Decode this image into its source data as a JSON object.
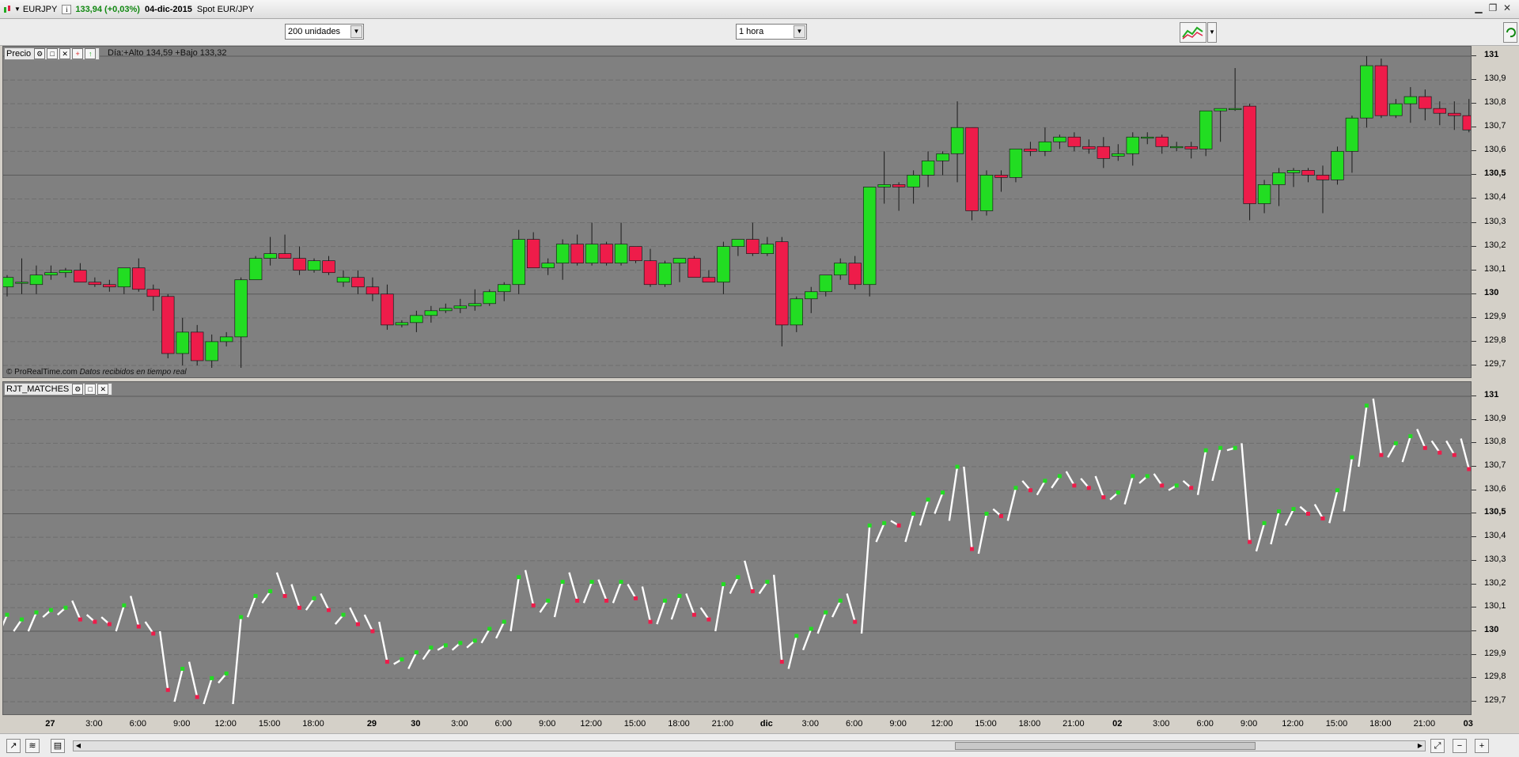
{
  "titlebar": {
    "symbol": "EURJPY",
    "info_glyph": "i",
    "price_change": "133,94 (+0,03%)",
    "date": "04-dic-2015",
    "description": "Spot EUR/JPY"
  },
  "toolbar": {
    "units_select": "200 unidades",
    "timeframe_select": "1 hora"
  },
  "price_panel": {
    "name": "Precio",
    "day_stats": "Día:+Alto 134,59 +Bajo 133,32",
    "credit": "© ProRealTime.com",
    "credit_note": "Datos recibidos en tiempo real"
  },
  "indicator_panel": {
    "name": "RJT_MATCHES"
  },
  "colors": {
    "background": "#808080",
    "up": "#22dd22",
    "down": "#ee1c4a",
    "line": "#ffffff"
  },
  "icons": {
    "titlebar": [
      "chart-symbol-icon",
      "info-icon"
    ],
    "panel_header": [
      "wrench-icon",
      "maximize-icon",
      "close-icon",
      "add-icon",
      "move-up-icon"
    ],
    "bottom": [
      "zoom-in-icon",
      "zoom-out-icon",
      "zoom-fit-icon"
    ]
  },
  "chart_data": {
    "type": "candlestick",
    "y_range": [
      129.67,
      131.02
    ],
    "y_ticks": [
      "131",
      "130,9",
      "130,8",
      "130,7",
      "130,6",
      "130,5",
      "130,4",
      "130,3",
      "130,2",
      "130,1",
      "130",
      "129,9",
      "129,8",
      "129,7"
    ],
    "y_major": [
      "131",
      "130,5",
      "130"
    ],
    "x_ticks": [
      {
        "label": "27",
        "idx": 3,
        "major": true
      },
      {
        "label": "3:00",
        "idx": 6
      },
      {
        "label": "6:00",
        "idx": 9
      },
      {
        "label": "9:00",
        "idx": 12
      },
      {
        "label": "12:00",
        "idx": 15
      },
      {
        "label": "15:00",
        "idx": 18
      },
      {
        "label": "18:00",
        "idx": 21
      },
      {
        "label": "29",
        "idx": 25,
        "major": true
      },
      {
        "label": "30",
        "idx": 28,
        "major": true
      },
      {
        "label": "3:00",
        "idx": 31
      },
      {
        "label": "6:00",
        "idx": 34
      },
      {
        "label": "9:00",
        "idx": 37
      },
      {
        "label": "12:00",
        "idx": 40
      },
      {
        "label": "15:00",
        "idx": 43
      },
      {
        "label": "18:00",
        "idx": 46
      },
      {
        "label": "21:00",
        "idx": 49
      },
      {
        "label": "dic",
        "idx": 52,
        "major": true
      },
      {
        "label": "3:00",
        "idx": 55
      },
      {
        "label": "6:00",
        "idx": 58
      },
      {
        "label": "9:00",
        "idx": 61
      },
      {
        "label": "12:00",
        "idx": 64
      },
      {
        "label": "15:00",
        "idx": 67
      },
      {
        "label": "18:00",
        "idx": 70
      },
      {
        "label": "21:00",
        "idx": 73
      },
      {
        "label": "02",
        "idx": 76,
        "major": true
      },
      {
        "label": "3:00",
        "idx": 79
      },
      {
        "label": "6:00",
        "idx": 82
      },
      {
        "label": "9:00",
        "idx": 85
      },
      {
        "label": "12:00",
        "idx": 88
      },
      {
        "label": "15:00",
        "idx": 91
      },
      {
        "label": "18:00",
        "idx": 94
      },
      {
        "label": "21:00",
        "idx": 97
      },
      {
        "label": "03",
        "idx": 100,
        "major": true
      }
    ],
    "ohlc": [
      [
        130.03,
        130.08,
        129.99,
        130.07
      ],
      [
        130.05,
        130.15,
        130.0,
        130.05
      ],
      [
        130.04,
        130.12,
        130.0,
        130.08
      ],
      [
        130.08,
        130.12,
        130.06,
        130.09
      ],
      [
        130.09,
        130.11,
        130.07,
        130.1
      ],
      [
        130.1,
        130.13,
        130.06,
        130.05
      ],
      [
        130.05,
        130.07,
        130.03,
        130.04
      ],
      [
        130.04,
        130.06,
        130.01,
        130.03
      ],
      [
        130.03,
        130.11,
        130.0,
        130.11
      ],
      [
        130.11,
        130.15,
        130.01,
        130.02
      ],
      [
        130.02,
        130.04,
        129.93,
        129.99
      ],
      [
        129.99,
        130.0,
        129.73,
        129.75
      ],
      [
        129.75,
        129.9,
        129.7,
        129.84
      ],
      [
        129.84,
        129.87,
        129.7,
        129.72
      ],
      [
        129.72,
        129.83,
        129.69,
        129.8
      ],
      [
        129.8,
        129.84,
        129.78,
        129.82
      ],
      [
        129.82,
        130.07,
        129.69,
        130.06
      ],
      [
        130.06,
        130.16,
        130.06,
        130.15
      ],
      [
        130.15,
        130.24,
        130.12,
        130.17
      ],
      [
        130.17,
        130.25,
        130.16,
        130.15
      ],
      [
        130.15,
        130.2,
        130.08,
        130.1
      ],
      [
        130.1,
        130.15,
        130.09,
        130.14
      ],
      [
        130.14,
        130.16,
        130.08,
        130.09
      ],
      [
        130.05,
        130.1,
        130.03,
        130.07
      ],
      [
        130.07,
        130.1,
        130.0,
        130.03
      ],
      [
        130.03,
        130.07,
        129.97,
        130.0
      ],
      [
        130.0,
        130.04,
        129.85,
        129.87
      ],
      [
        129.87,
        129.89,
        129.86,
        129.88
      ],
      [
        129.88,
        129.93,
        129.84,
        129.91
      ],
      [
        129.91,
        129.95,
        129.88,
        129.93
      ],
      [
        129.93,
        129.96,
        129.92,
        129.94
      ],
      [
        129.94,
        129.98,
        129.92,
        129.95
      ],
      [
        129.95,
        130.02,
        129.93,
        129.96
      ],
      [
        129.96,
        130.02,
        129.95,
        130.01
      ],
      [
        130.01,
        130.05,
        129.97,
        130.04
      ],
      [
        130.04,
        130.27,
        130.0,
        130.23
      ],
      [
        130.23,
        130.26,
        130.11,
        130.11
      ],
      [
        130.11,
        130.15,
        130.08,
        130.13
      ],
      [
        130.13,
        130.23,
        130.06,
        130.21
      ],
      [
        130.21,
        130.25,
        130.12,
        130.13
      ],
      [
        130.13,
        130.3,
        130.12,
        130.21
      ],
      [
        130.21,
        130.22,
        130.12,
        130.13
      ],
      [
        130.13,
        130.3,
        130.12,
        130.21
      ],
      [
        130.2,
        130.2,
        130.13,
        130.14
      ],
      [
        130.14,
        130.19,
        130.03,
        130.04
      ],
      [
        130.04,
        130.14,
        130.03,
        130.13
      ],
      [
        130.13,
        130.15,
        130.05,
        130.15
      ],
      [
        130.15,
        130.16,
        130.07,
        130.07
      ],
      [
        130.07,
        130.1,
        130.05,
        130.05
      ],
      [
        130.05,
        130.22,
        130.0,
        130.2
      ],
      [
        130.2,
        130.23,
        130.16,
        130.23
      ],
      [
        130.23,
        130.3,
        130.16,
        130.17
      ],
      [
        130.17,
        130.24,
        130.16,
        130.21
      ],
      [
        130.22,
        130.24,
        129.78,
        129.87
      ],
      [
        129.87,
        129.99,
        129.84,
        129.98
      ],
      [
        129.98,
        130.03,
        129.92,
        130.01
      ],
      [
        130.01,
        130.08,
        129.99,
        130.08
      ],
      [
        130.08,
        130.15,
        130.06,
        130.13
      ],
      [
        130.13,
        130.16,
        130.02,
        130.04
      ],
      [
        130.04,
        130.44,
        129.99,
        130.45
      ],
      [
        130.45,
        130.6,
        130.38,
        130.46
      ],
      [
        130.46,
        130.47,
        130.35,
        130.45
      ],
      [
        130.45,
        130.52,
        130.38,
        130.5
      ],
      [
        130.5,
        130.6,
        130.45,
        130.56
      ],
      [
        130.56,
        130.6,
        130.5,
        130.59
      ],
      [
        130.59,
        130.81,
        130.47,
        130.7
      ],
      [
        130.7,
        130.7,
        130.31,
        130.35
      ],
      [
        130.35,
        130.52,
        130.33,
        130.5
      ],
      [
        130.5,
        130.52,
        130.43,
        130.49
      ],
      [
        130.49,
        130.61,
        130.47,
        130.61
      ],
      [
        130.61,
        130.64,
        130.58,
        130.6
      ],
      [
        130.6,
        130.7,
        130.58,
        130.64
      ],
      [
        130.64,
        130.67,
        130.61,
        130.66
      ],
      [
        130.66,
        130.68,
        130.6,
        130.62
      ],
      [
        130.62,
        130.65,
        130.59,
        130.61
      ],
      [
        130.62,
        130.66,
        130.53,
        130.57
      ],
      [
        130.58,
        130.63,
        130.56,
        130.59
      ],
      [
        130.59,
        130.68,
        130.54,
        130.66
      ],
      [
        130.66,
        130.68,
        130.63,
        130.66
      ],
      [
        130.66,
        130.67,
        130.59,
        130.62
      ],
      [
        130.62,
        130.64,
        130.6,
        130.62
      ],
      [
        130.62,
        130.64,
        130.57,
        130.61
      ],
      [
        130.61,
        130.77,
        130.58,
        130.77
      ],
      [
        130.77,
        130.78,
        130.64,
        130.78
      ],
      [
        130.78,
        130.95,
        130.77,
        130.78
      ],
      [
        130.79,
        130.8,
        130.31,
        130.38
      ],
      [
        130.38,
        130.48,
        130.34,
        130.46
      ],
      [
        130.46,
        130.53,
        130.37,
        130.51
      ],
      [
        130.51,
        130.53,
        130.45,
        130.52
      ],
      [
        130.52,
        130.53,
        130.47,
        130.5
      ],
      [
        130.5,
        130.54,
        130.34,
        130.48
      ],
      [
        130.48,
        130.62,
        130.46,
        130.6
      ],
      [
        130.6,
        130.75,
        130.51,
        130.74
      ],
      [
        130.74,
        131.0,
        130.7,
        130.96
      ],
      [
        130.96,
        130.99,
        130.74,
        130.75
      ],
      [
        130.75,
        130.82,
        130.74,
        130.8
      ],
      [
        130.8,
        130.87,
        130.72,
        130.83
      ],
      [
        130.83,
        130.86,
        130.73,
        130.78
      ],
      [
        130.78,
        130.81,
        130.71,
        130.76
      ],
      [
        130.76,
        130.81,
        130.69,
        130.75
      ],
      [
        130.75,
        130.82,
        130.68,
        130.69
      ]
    ]
  }
}
